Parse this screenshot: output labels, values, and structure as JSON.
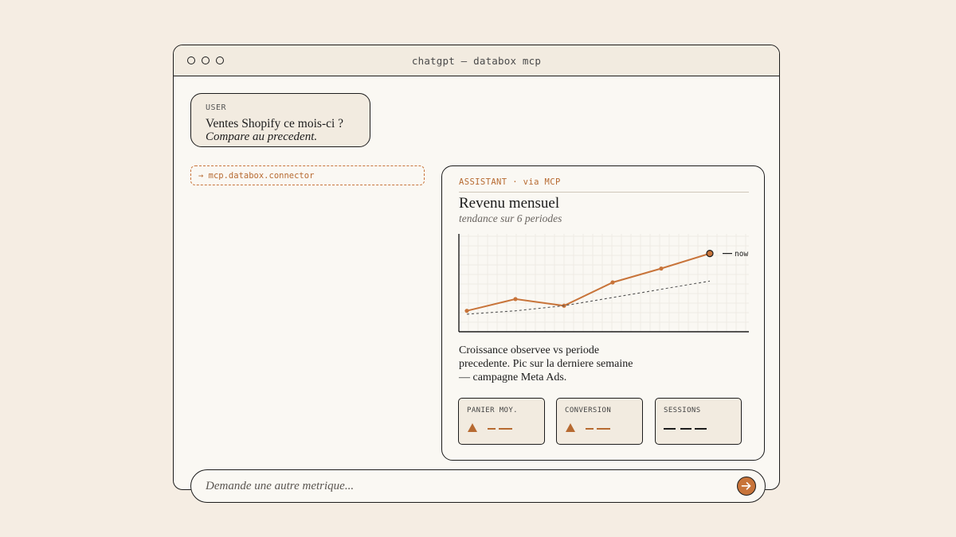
{
  "window": {
    "title": "chatgpt — databox mcp"
  },
  "user_message": {
    "tag": "USER",
    "line1": "Ventes Shopify ce mois-ci ?",
    "line2": "Compare au precedent."
  },
  "connector": {
    "label": "→ mcp.databox.connector"
  },
  "assistant": {
    "tag": "ASSISTANT · via MCP",
    "title": "Revenu mensuel",
    "subtitle": "tendance sur 6 periodes",
    "text": "Croissance observee vs periode precedente. Pic sur la derniere semaine — campagne Meta Ads.",
    "kpis": [
      {
        "label": "PANIER MOY.",
        "trend": "up",
        "value": "— ——"
      },
      {
        "label": "CONVERSION",
        "trend": "up",
        "value": "— ——"
      },
      {
        "label": "SESSIONS",
        "trend": "none",
        "value": "— ——"
      }
    ]
  },
  "chart_data": {
    "type": "line",
    "x": [
      1,
      2,
      3,
      4,
      5,
      6
    ],
    "series": [
      {
        "values": [
          10.7,
          16.7,
          13.3,
          25.2,
          32.3,
          40.0
        ],
        "color": "#c8743a",
        "style": "solid"
      },
      {
        "values": [
          9.0,
          10.7,
          13.3,
          17.5,
          21.7,
          25.9
        ],
        "color": "#555555",
        "style": "dashed"
      }
    ],
    "annotation": "now",
    "ylim": [
      0,
      50
    ],
    "grid": true
  },
  "input": {
    "placeholder": "Demande une autre metrique..."
  },
  "colors": {
    "accent": "#c8743a",
    "background": "#f5ede3",
    "panel": "#f2ebe0",
    "ink": "#1c1c1c"
  },
  "icons": {
    "send": "arrow-right-icon",
    "window_controls": "circle-icon"
  }
}
